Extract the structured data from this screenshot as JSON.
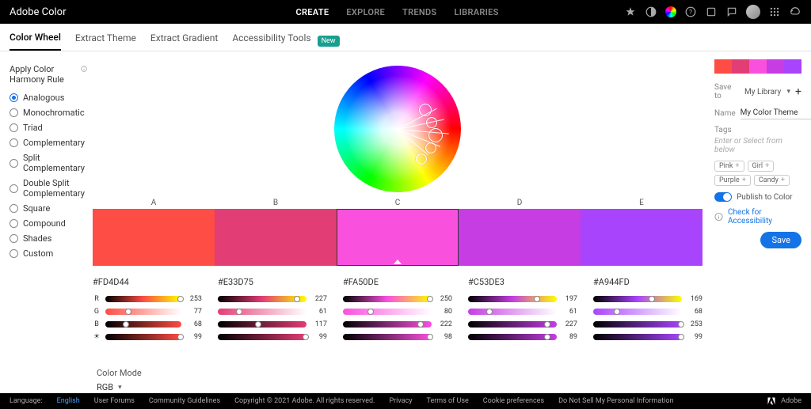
{
  "brand": "Adobe Color",
  "nav": {
    "items": [
      "CREATE",
      "EXPLORE",
      "TRENDS",
      "LIBRARIES"
    ],
    "active": 0
  },
  "subnav": {
    "items": [
      "Color Wheel",
      "Extract Theme",
      "Extract Gradient",
      "Accessibility Tools"
    ],
    "active": 0,
    "new_badge": "New"
  },
  "harmony": {
    "title": "Apply Color Harmony Rule",
    "items": [
      "Analogous",
      "Monochromatic",
      "Triad",
      "Complementary",
      "Split Complementary",
      "Double Split Complementary",
      "Square",
      "Compound",
      "Shades",
      "Custom"
    ],
    "selected": 0
  },
  "swatches": {
    "labels": [
      "A",
      "B",
      "C",
      "D",
      "E"
    ],
    "base_index": 2,
    "colors": [
      {
        "hex": "#FD4D44",
        "r": 253,
        "g": 77,
        "b": 68,
        "br": 99
      },
      {
        "hex": "#E33D75",
        "r": 227,
        "g": 61,
        "b": 117,
        "br": 99
      },
      {
        "hex": "#FA50DE",
        "r": 250,
        "g": 80,
        "b": 222,
        "br": 98
      },
      {
        "hex": "#C53DE3",
        "r": 197,
        "g": 61,
        "b": 227,
        "br": 89
      },
      {
        "hex": "#A944FD",
        "r": 169,
        "g": 68,
        "b": 253,
        "br": 99
      }
    ]
  },
  "channels": [
    "R",
    "G",
    "B"
  ],
  "color_mode": {
    "label": "Color Mode",
    "value": "RGB"
  },
  "right": {
    "saveto_label": "Save to",
    "library": "My Library",
    "name_label": "Name",
    "name_value": "My Color Theme",
    "tags_label": "Tags",
    "tags_placeholder": "Enter or Select from below",
    "tags": [
      "Pink",
      "Girl",
      "Purple",
      "Candy"
    ],
    "publish": "Publish to Color",
    "accessibility": "Check for Accessibility",
    "save": "Save"
  },
  "footer": {
    "lang_label": "Language:",
    "lang": "English",
    "links": [
      "User Forums",
      "Community Guidelines"
    ],
    "copyright": "Copyright © 2021 Adobe. All rights reserved.",
    "legal": [
      "Privacy",
      "Terms of Use",
      "Cookie preferences",
      "Do Not Sell My Personal Information"
    ],
    "brand": "Adobe"
  }
}
